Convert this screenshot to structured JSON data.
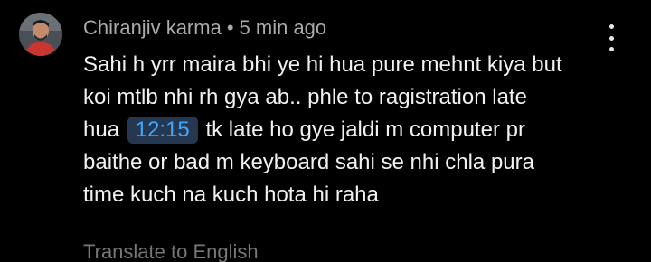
{
  "comment": {
    "author": "Chiranjiv karma",
    "separator": "•",
    "time_ago": "5 min ago",
    "text_lines": [
      "Sahi h yrr maira bhi ye hi hua pure mehnt kiya but",
      "koi mtlb nhi rh gya ab.. phle to ragistration late",
      "hua",
      "tk late ho gye jaldi m computer pr",
      "baithe or bad m keyboard sahi se nhi chla pura",
      "time kuch na kuch hota hi raha"
    ],
    "timestamp_link": "12:15",
    "translate_label": "Translate to English",
    "more_options_icon": "vertical-ellipsis",
    "colors": {
      "background": "#000000",
      "author_text": "#aaaaaa",
      "body_text": "#f1f1f1",
      "timestamp_text": "#3ea6ff",
      "timestamp_bg": "#263850",
      "translate_text": "#777777"
    }
  }
}
